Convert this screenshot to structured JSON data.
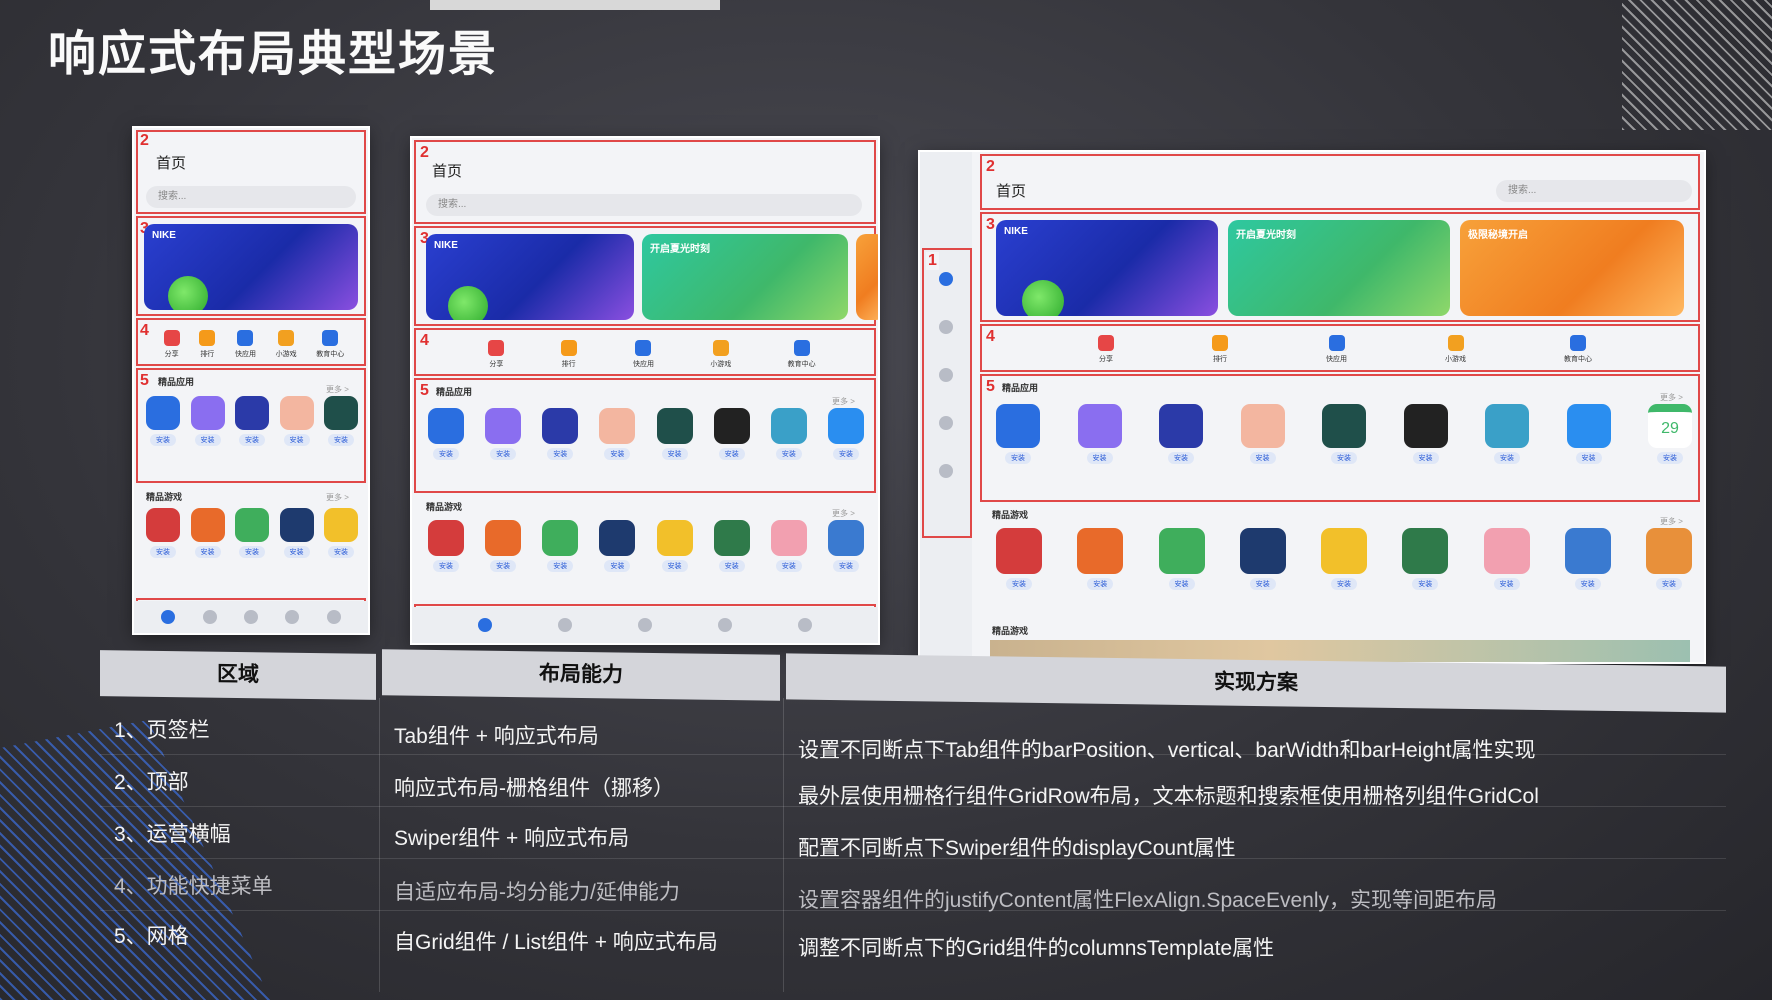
{
  "slide": {
    "title": "响应式布局典型场景"
  },
  "mock": {
    "page_title": "首页",
    "search_placeholder": "搜索...",
    "banner1_title": "NIKE",
    "banner2_title": "开启夏光时刻",
    "banner3_title": "极限秘境开启",
    "quick": [
      "分享",
      "排行",
      "快应用",
      "小游戏",
      "教育中心"
    ],
    "section_apps": "精品应用",
    "section_games": "精品游戏",
    "section_more": "更多 >",
    "install": "安装",
    "zone_labels": [
      "1",
      "2",
      "3",
      "4",
      "5"
    ],
    "date_app": "29"
  },
  "table": {
    "headers": [
      "区域",
      "布局能力",
      "实现方案"
    ],
    "rows": [
      {
        "area": "1、页签栏",
        "ability": "Tab组件 + 响应式布局",
        "solution": "设置不同断点下Tab组件的barPosition、vertical、barWidth和barHeight属性实现"
      },
      {
        "area": "2、顶部",
        "ability": "响应式布局-栅格组件（挪移）",
        "solution": "最外层使用栅格行组件GridRow布局，文本标题和搜索框使用栅格列组件GridCol"
      },
      {
        "area": "3、运营横幅",
        "ability": "Swiper组件 + 响应式布局",
        "solution": "配置不同断点下Swiper组件的displayCount属性"
      },
      {
        "area": "4、功能快捷菜单",
        "ability": "自适应布局-均分能力/延伸能力",
        "solution": "设置容器组件的justifyContent属性FlexAlign.SpaceEvenly，实现等间距布局"
      },
      {
        "area": "5、网格",
        "ability": "自Grid组件 / List组件 + 响应式布局",
        "solution": "调整不同断点下的Grid组件的columnsTemplate属性"
      }
    ]
  },
  "colors": {
    "zone_border": "#e04848",
    "accent": "#2a6ee0"
  }
}
